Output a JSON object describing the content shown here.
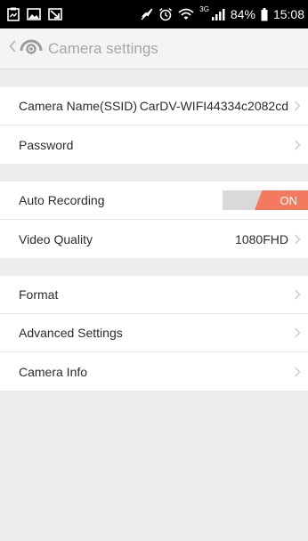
{
  "status_bar": {
    "network_type": "3G",
    "battery_percent": "84%",
    "time": "15:08",
    "icons": [
      "clipboard-icon",
      "image-icon",
      "download-icon",
      "mute-icon",
      "alarm-icon",
      "wifi-icon",
      "signal-icon",
      "battery-icon"
    ]
  },
  "header": {
    "title": "Camera settings",
    "back_icon": "chevron-left-icon",
    "camera_icon": "camera-icon"
  },
  "groups": [
    {
      "rows": [
        {
          "name": "camera-name-row",
          "label": "Camera Name(SSID)",
          "value": "CarDV-WIFI44334c2082cd",
          "chevron": true
        },
        {
          "name": "password-row",
          "label": "Password",
          "value": "",
          "chevron": true
        }
      ]
    },
    {
      "rows": [
        {
          "name": "auto-recording-row",
          "label": "Auto Recording",
          "toggle": {
            "state": "ON",
            "on": true
          }
        },
        {
          "name": "video-quality-row",
          "label": "Video Quality",
          "value": "1080FHD",
          "chevron": true
        }
      ]
    },
    {
      "rows": [
        {
          "name": "format-row",
          "label": "Format",
          "value": "",
          "chevron": true
        },
        {
          "name": "advanced-settings-row",
          "label": "Advanced Settings",
          "value": "",
          "chevron": true
        },
        {
          "name": "camera-info-row",
          "label": "Camera Info",
          "value": "",
          "chevron": true
        }
      ]
    }
  ],
  "colors": {
    "toggle_on": "#f47a5f",
    "toggle_off": "#d9d9d9",
    "background": "#ececec",
    "header_text": "#a6a6a6"
  }
}
